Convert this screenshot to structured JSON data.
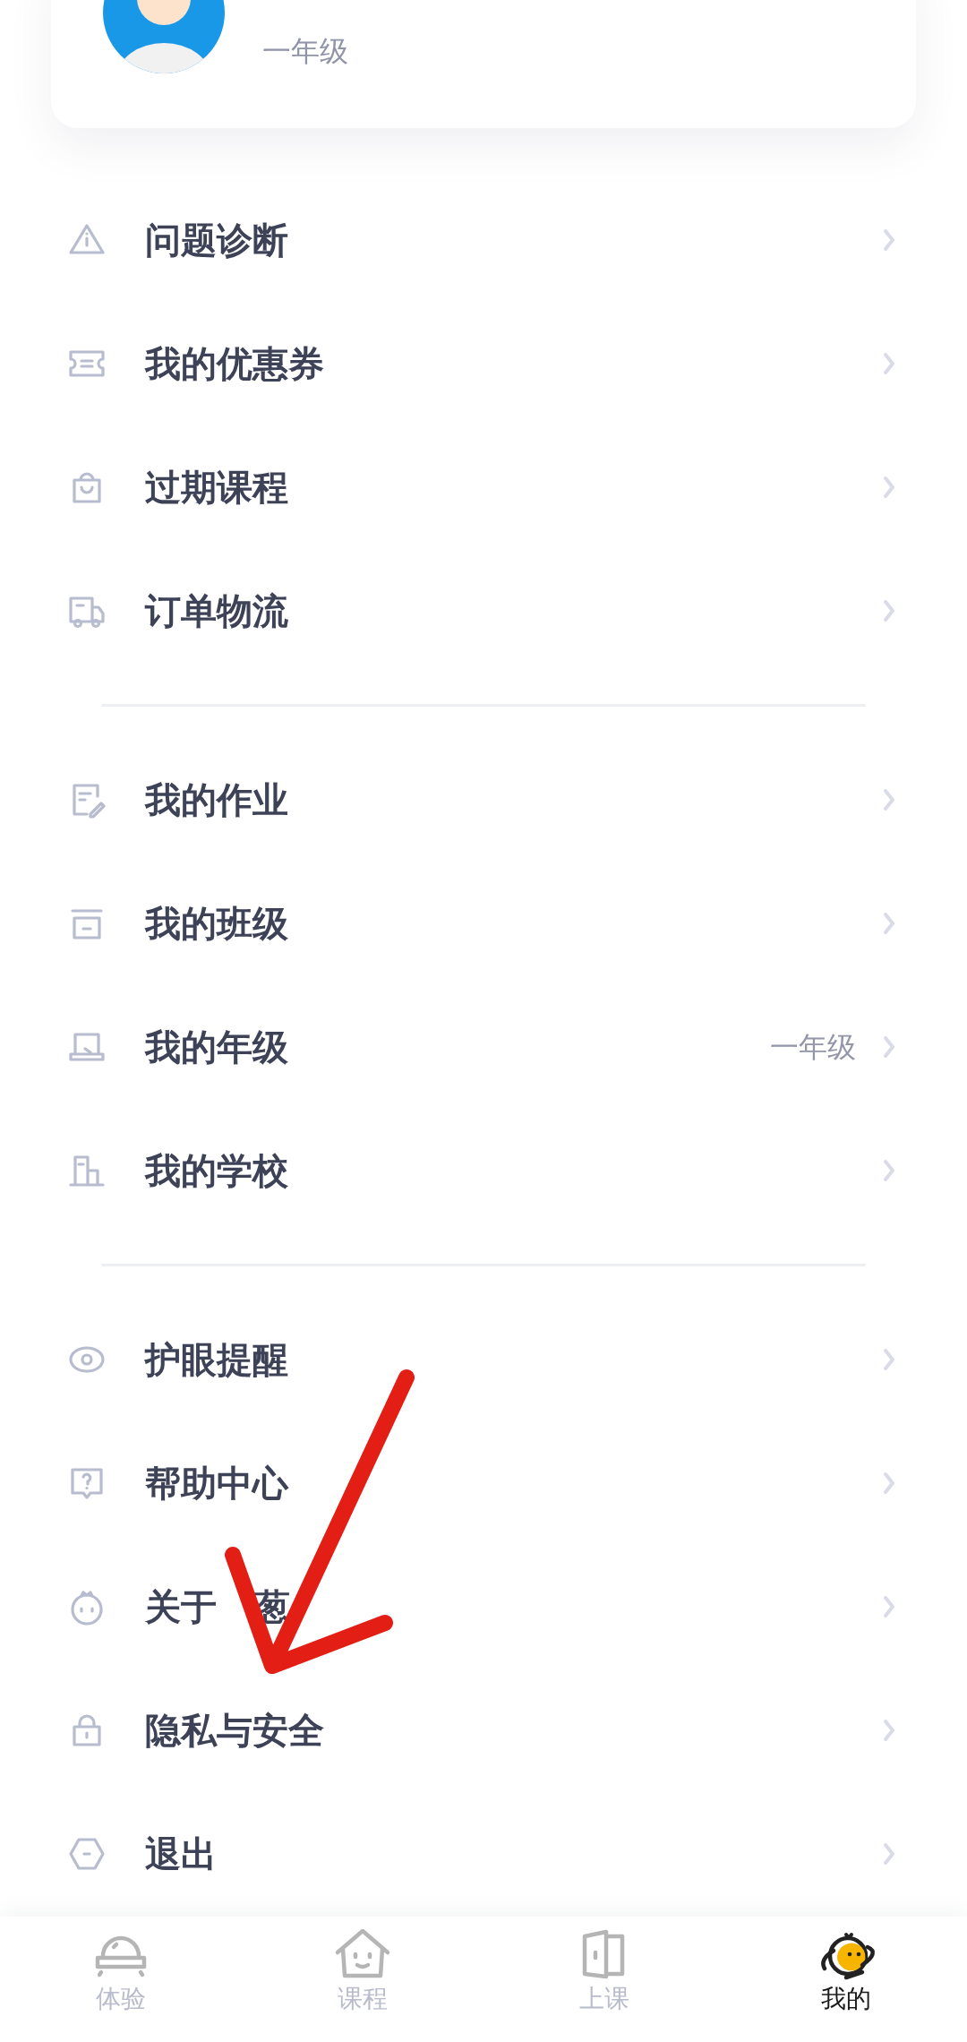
{
  "profile": {
    "grade": "一年级"
  },
  "menu_groups": [
    {
      "items": [
        {
          "label": "问题诊断"
        },
        {
          "label": "我的优惠券"
        },
        {
          "label": "过期课程"
        },
        {
          "label": "订单物流"
        }
      ]
    },
    {
      "items": [
        {
          "label": "我的作业"
        },
        {
          "label": "我的班级"
        },
        {
          "label": "我的年级",
          "value": "一年级"
        },
        {
          "label": "我的学校"
        }
      ]
    },
    {
      "items": [
        {
          "label": "护眼提醒"
        },
        {
          "label": "帮助中心"
        },
        {
          "label": "关于",
          "label_after_cover": "葱"
        },
        {
          "label": "隐私与安全"
        },
        {
          "label": "退出"
        }
      ]
    }
  ],
  "tabs": [
    {
      "label": "体验",
      "selected": false
    },
    {
      "label": "课程",
      "selected": false
    },
    {
      "label": "上课",
      "selected": false
    },
    {
      "label": "我的",
      "selected": true
    }
  ]
}
